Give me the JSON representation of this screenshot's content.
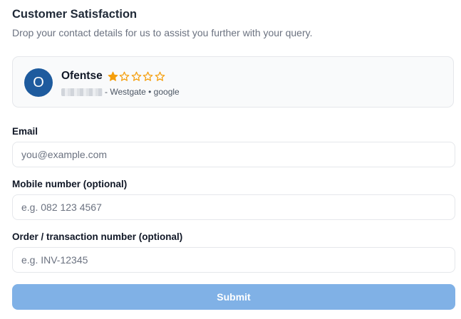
{
  "header": {
    "title": "Customer Satisfaction",
    "subtitle": "Drop your contact details for us to assist you further with your query."
  },
  "review_card": {
    "avatar_initial": "O",
    "reviewer_name": "Ofentse",
    "rating": 1,
    "rating_max": 5,
    "meta_text": "- Westgate • google",
    "colors": {
      "avatar": "#1e5b9e",
      "star": "#f59e0b"
    }
  },
  "form": {
    "email": {
      "label": "Email",
      "value": "",
      "placeholder": "you@example.com"
    },
    "mobile": {
      "label": "Mobile number (optional)",
      "value": "",
      "placeholder": "e.g. 082 123 4567"
    },
    "order": {
      "label": "Order / transaction number (optional)",
      "value": "",
      "placeholder": "e.g. INV-12345"
    },
    "submit_label": "Submit",
    "submit_color": "#80b1e6"
  }
}
